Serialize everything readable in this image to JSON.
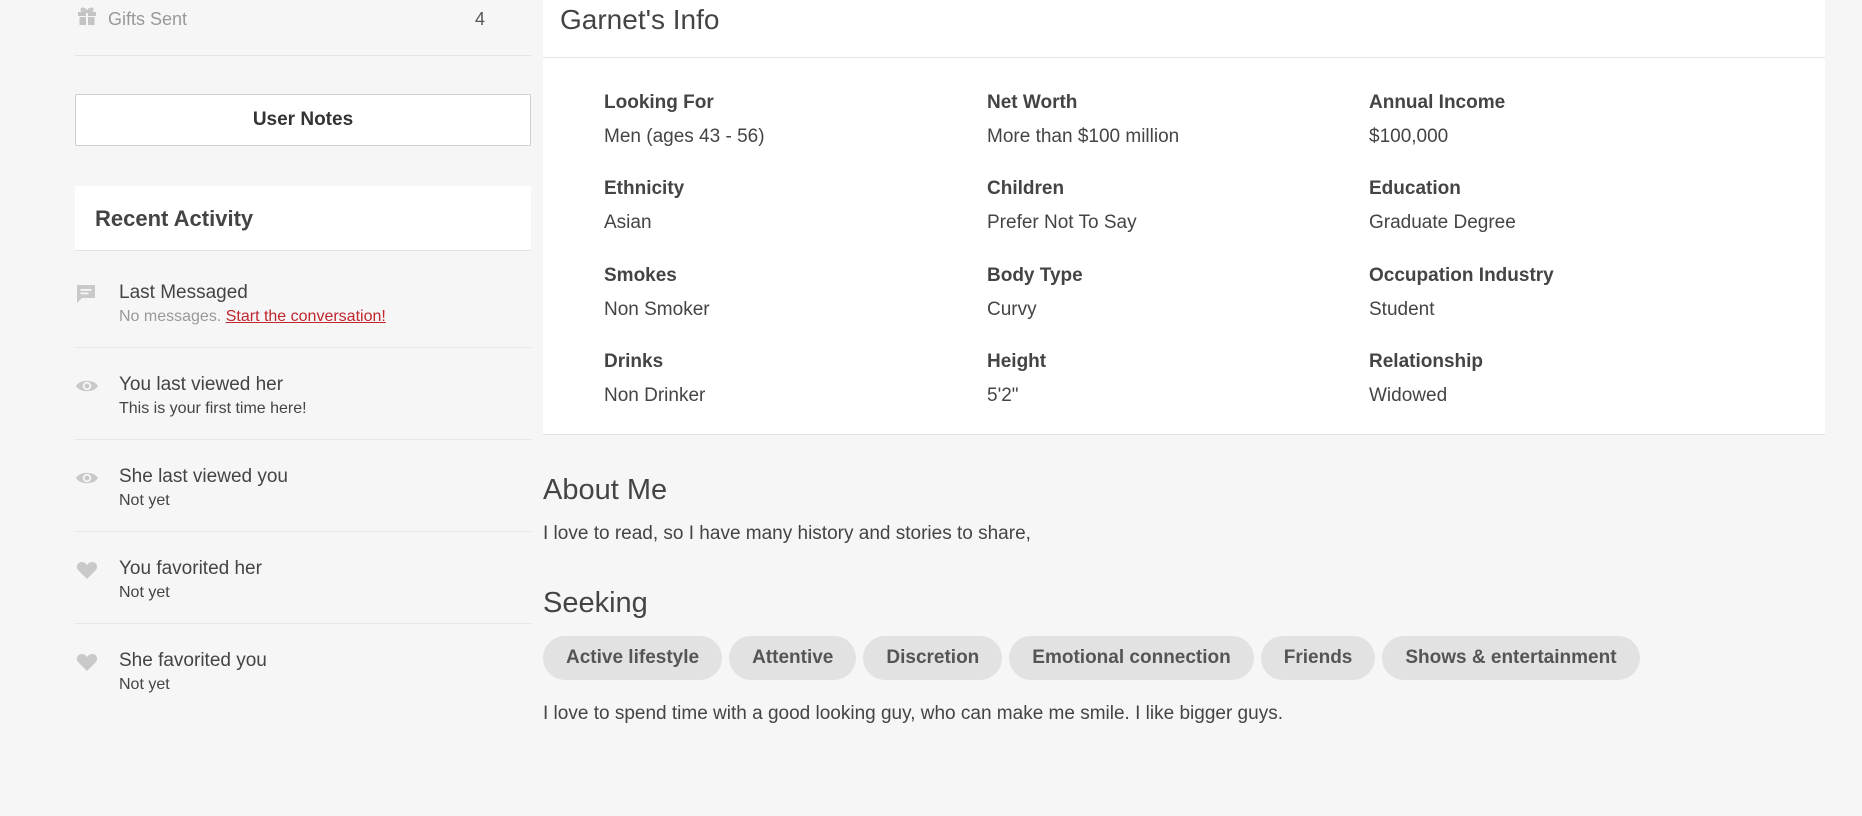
{
  "sidebar": {
    "gifts_sent": {
      "label": "Gifts Sent",
      "count": "4"
    },
    "user_notes_label": "User Notes",
    "recent_activity_title": "Recent Activity",
    "activity": [
      {
        "icon": "message-icon",
        "title": "Last Messaged",
        "sub": "No messages. ",
        "link": "Start the conversation!"
      },
      {
        "icon": "eye-icon",
        "title": "You last viewed her",
        "sub": "This is your first time here!"
      },
      {
        "icon": "eye-icon",
        "title": "She last viewed you",
        "sub": "Not yet"
      },
      {
        "icon": "heart-icon",
        "title": "You favorited her",
        "sub": "Not yet"
      },
      {
        "icon": "heart-icon",
        "title": "She favorited you",
        "sub": "Not yet"
      }
    ]
  },
  "info": {
    "title": "Garnet's Info",
    "fields": [
      {
        "label": "Looking For",
        "value": "Men (ages 43 - 56)"
      },
      {
        "label": "Net Worth",
        "value": "More than $100 million"
      },
      {
        "label": "Annual Income",
        "value": "$100,000"
      },
      {
        "label": "Ethnicity",
        "value": "Asian"
      },
      {
        "label": "Children",
        "value": "Prefer Not To Say"
      },
      {
        "label": "Education",
        "value": "Graduate Degree"
      },
      {
        "label": "Smokes",
        "value": "Non Smoker"
      },
      {
        "label": "Body Type",
        "value": "Curvy"
      },
      {
        "label": "Occupation Industry",
        "value": "Student"
      },
      {
        "label": "Drinks",
        "value": "Non Drinker"
      },
      {
        "label": "Height",
        "value": "5'2\""
      },
      {
        "label": "Relationship",
        "value": "Widowed"
      }
    ]
  },
  "about": {
    "title": "About Me",
    "text": "I love to read, so I have many history and stories to share,"
  },
  "seeking": {
    "title": "Seeking",
    "tags": [
      "Active lifestyle",
      "Attentive",
      "Discretion",
      "Emotional connection",
      "Friends",
      "Shows & entertainment"
    ],
    "text": "I love to spend time with a good looking guy, who can make me smile. I like bigger guys."
  },
  "colors": {
    "link": "#c0262d",
    "icon": "#c9c9c9",
    "tag_bg": "#e2e2e2",
    "page_bg": "#f6f6f6"
  }
}
